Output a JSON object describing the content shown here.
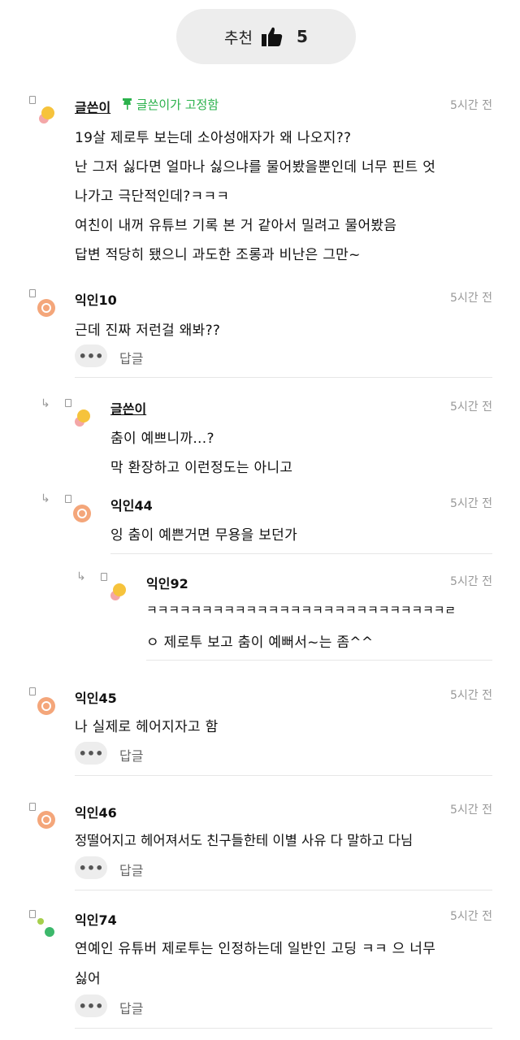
{
  "recommend": {
    "label": "추천",
    "count": "5"
  },
  "colors": {
    "accent_green": "#2bb24c",
    "bg_button": "#ededed",
    "muted": "#999999"
  },
  "comments": [
    {
      "author": "글쓴이",
      "pinned": "글쓴이가 고정함",
      "time": "5시간 전",
      "lines": [
        "19살 제로투 보는데 소아성애자가 왜 나오지??",
        "난 그저 싫다면 얼마나 싫으냐를 물어봤을뿐인데 너무 핀트 엇",
        "나가고 극단적인데?ㅋㅋㅋ",
        "여친이 내꺼 유튜브 기록 본 거 같아서 밀려고 물어봤음",
        "답변 적당히 됐으니 과도한 조롱과 비난은 그만~"
      ]
    },
    {
      "author": "익인10",
      "time": "5시간 전",
      "lines": [
        "근데 진짜 저런걸 왜봐??"
      ],
      "reply": "답글"
    },
    {
      "author": "글쓴이",
      "time": "5시간 전",
      "lines": [
        "춤이 예쁘니까...?",
        "막 환장하고 이런정도는 아니고"
      ]
    },
    {
      "author": "익인44",
      "time": "5시간 전",
      "lines": [
        "잉 춤이 예쁜거면 무용을 보던가"
      ]
    },
    {
      "author": "익인92",
      "time": "5시간 전",
      "lines": [
        "ㅋㅋㅋㅋㅋㅋㅋㅋㅋㅋㅋㅋㅋㅋㅋㅋㅋㅋㅋㅋㅋㅋㅋㅋㅋㅋㅋㄹ",
        "ㅇ 제로투 보고 춤이 예뻐서~는 좀^^"
      ]
    },
    {
      "author": "익인45",
      "time": "5시간 전",
      "lines": [
        "나 실제로 헤어지자고 함"
      ],
      "reply": "답글"
    },
    {
      "author": "익인46",
      "time": "5시간 전",
      "lines": [
        "정떨어지고 헤어져서도 친구들한테 이별 사유 다 말하고 다님"
      ],
      "reply": "답글"
    },
    {
      "author": "익인74",
      "time": "5시간 전",
      "lines": [
        "연예인 유튜버 제로투는 인정하는데 일반인 고딩 ㅋㅋ 으 너무",
        "싫어"
      ],
      "reply": "답글"
    }
  ]
}
